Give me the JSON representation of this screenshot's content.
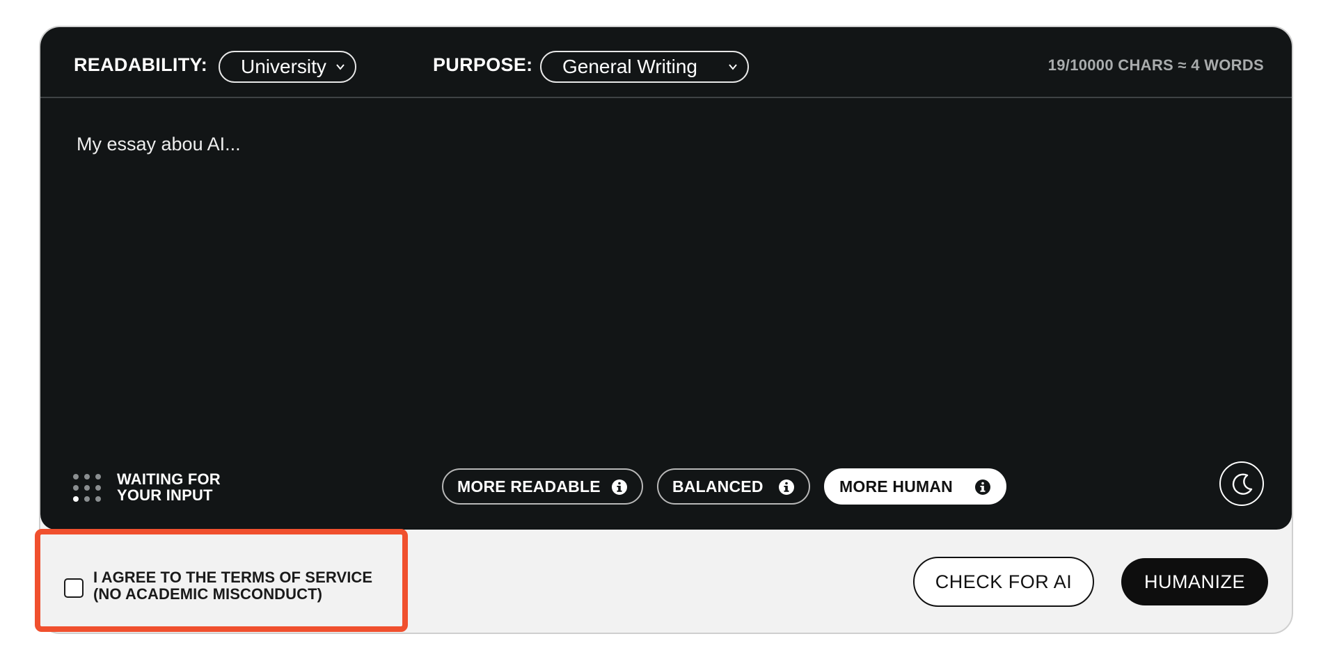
{
  "toolbar": {
    "readability_label": "READABILITY:",
    "readability_value": "University",
    "purpose_label": "PURPOSE:",
    "purpose_value": "General Writing",
    "char_count": "19/10000 CHARS ≈ 4 WORDS"
  },
  "editor": {
    "text": "My essay abou AI..."
  },
  "status": {
    "line1": "WAITING FOR",
    "line2": "YOUR INPUT",
    "icon": "dots-grid-icon"
  },
  "modes": [
    {
      "label": "MORE READABLE",
      "active": false,
      "icon": "info-icon"
    },
    {
      "label": "BALANCED",
      "active": false,
      "icon": "info-icon"
    },
    {
      "label": "MORE HUMAN",
      "active": true,
      "icon": "info-icon"
    }
  ],
  "theme_toggle": {
    "icon": "moon-icon"
  },
  "terms": {
    "line1": "I AGREE TO THE TERMS OF SERVICE",
    "line2": "(NO ACADEMIC MISCONDUCT)",
    "checked": false
  },
  "actions": {
    "check_label": "CHECK FOR AI",
    "humanize_label": "HUMANIZE"
  },
  "colors": {
    "editor_bg": "#121516",
    "page_bg": "#f2f2f2",
    "highlight": "#f0502e"
  }
}
